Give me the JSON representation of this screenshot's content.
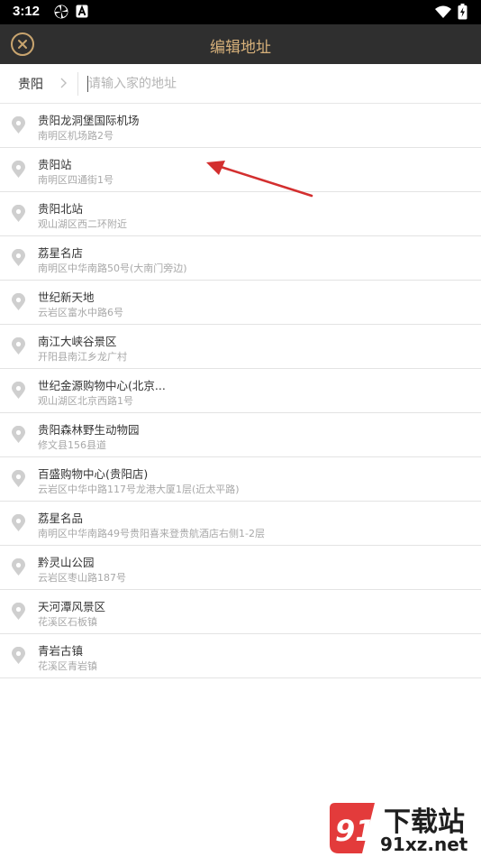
{
  "status_bar": {
    "time": "3:12"
  },
  "app_bar": {
    "title": "编辑地址"
  },
  "search": {
    "city": "贵阳",
    "placeholder": "请输入家的地址",
    "value": ""
  },
  "places": [
    {
      "name": "贵阳龙洞堡国际机场",
      "address": "南明区机场路2号"
    },
    {
      "name": "贵阳站",
      "address": "南明区四通街1号"
    },
    {
      "name": "贵阳北站",
      "address": "观山湖区西二环附近"
    },
    {
      "name": "荔星名店",
      "address": "南明区中华南路50号(大南门旁边)"
    },
    {
      "name": "世纪新天地",
      "address": "云岩区富水中路6号"
    },
    {
      "name": "南江大峡谷景区",
      "address": "开阳县南江乡龙广村"
    },
    {
      "name": "世纪金源购物中心(北京...",
      "address": "观山湖区北京西路1号"
    },
    {
      "name": "贵阳森林野生动物园",
      "address": "修文县156县道"
    },
    {
      "name": "百盛购物中心(贵阳店)",
      "address": "云岩区中华中路117号龙港大厦1层(近太平路)"
    },
    {
      "name": "荔星名品",
      "address": "南明区中华南路49号贵阳喜来登贵航酒店右侧1-2层"
    },
    {
      "name": "黔灵山公园",
      "address": "云岩区枣山路187号"
    },
    {
      "name": "天河潭风景区",
      "address": "花溪区石板镇"
    },
    {
      "name": "青岩古镇",
      "address": "花溪区青岩镇"
    }
  ],
  "watermark": {
    "title": "下载站",
    "url": "91xz.net",
    "logo_text": "91"
  },
  "colors": {
    "app_bar": "#2f2f2f",
    "accent": "#d6b07a",
    "annotation_arrow": "#d32f2f",
    "watermark_logo": "#e33b3b"
  }
}
